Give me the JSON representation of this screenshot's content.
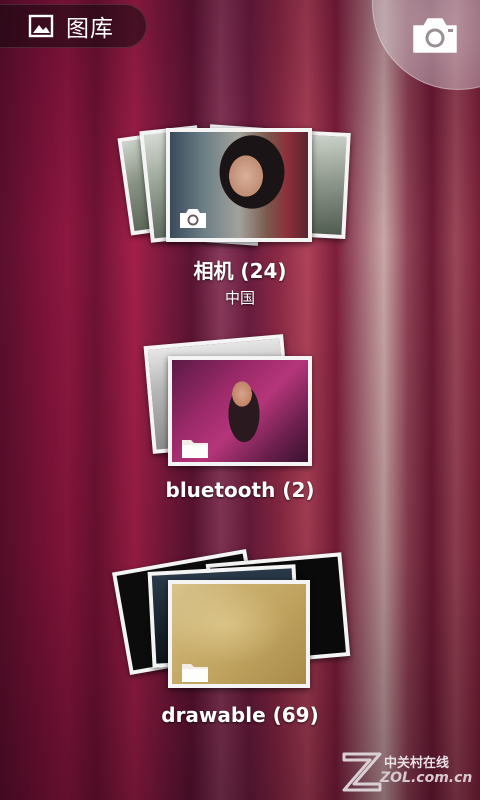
{
  "header": {
    "title": "图库",
    "title_icon": "picture-icon",
    "camera_icon": "camera-icon"
  },
  "albums": [
    {
      "name": "相机",
      "count": "(24)",
      "location": "中国",
      "badge_icon": "camera-icon"
    },
    {
      "name": "bluetooth",
      "count": "(2)",
      "badge_icon": "folder-icon"
    },
    {
      "name": "drawable",
      "count": "(69)",
      "badge_icon": "folder-icon"
    }
  ],
  "watermark": {
    "cn": "中关村在线",
    "en": "ZOL.com.cn"
  },
  "colors": {
    "background": "#7a1238",
    "frame": "#f4f4f4",
    "text": "#ffffff"
  }
}
